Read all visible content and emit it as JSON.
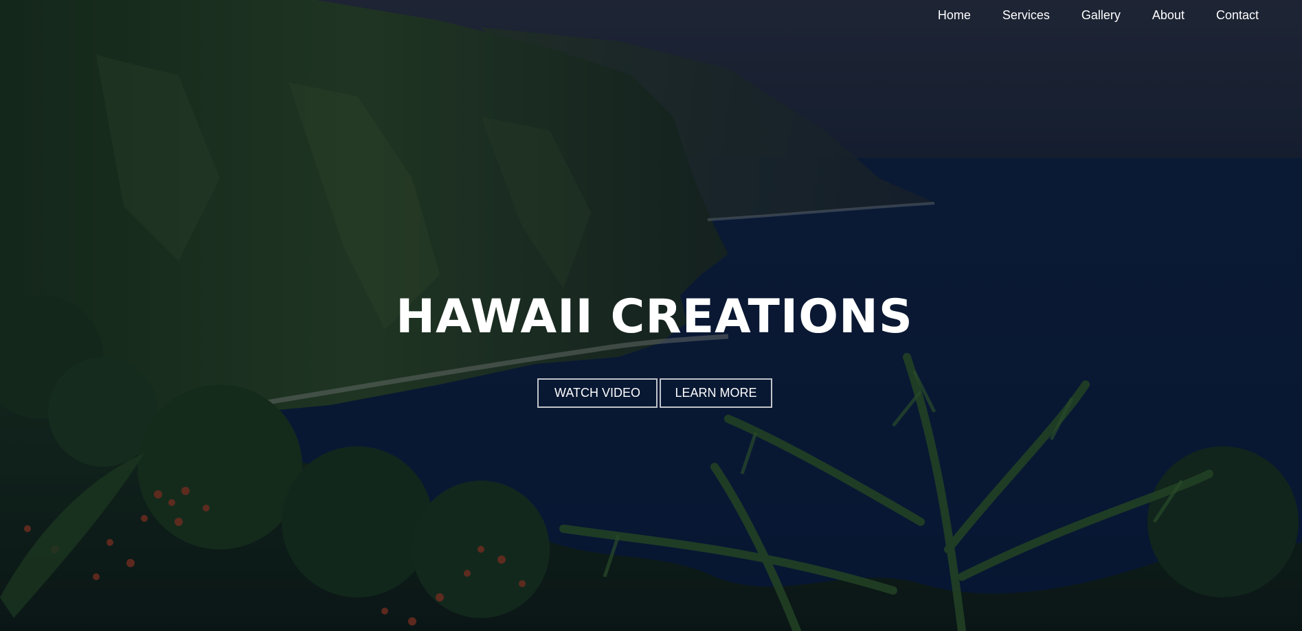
{
  "nav": {
    "items": [
      {
        "label": "Home"
      },
      {
        "label": "Services"
      },
      {
        "label": "Gallery"
      },
      {
        "label": "About"
      },
      {
        "label": "Contact"
      }
    ]
  },
  "hero": {
    "title": "HAWAII CREATIONS",
    "buttons": {
      "watch_video": "WATCH VIDEO",
      "learn_more": "LEARN MORE"
    }
  },
  "colors": {
    "text": "#ffffff",
    "ocean": "#0b2146",
    "cliff_green": "#24401f",
    "flowers": "#a13a1f"
  }
}
